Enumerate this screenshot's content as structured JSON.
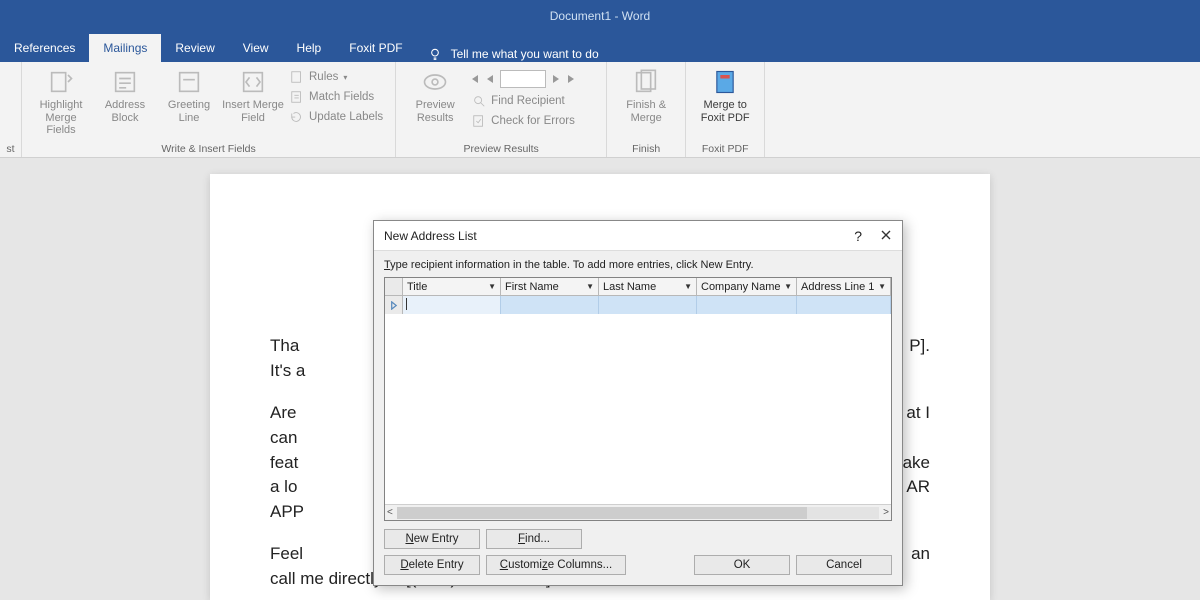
{
  "titlebar": {
    "title": "Document1  -  Word"
  },
  "tabs": [
    {
      "label": "References"
    },
    {
      "label": "Mailings",
      "active": true
    },
    {
      "label": "Review"
    },
    {
      "label": "View"
    },
    {
      "label": "Help"
    },
    {
      "label": "Foxit PDF"
    }
  ],
  "tellme": {
    "label": "Tell me what you want to do"
  },
  "ribbon": {
    "truncated": {
      "label": "st"
    },
    "writeInsert": {
      "label": "Write & Insert Fields",
      "highlight": "Highlight Merge Fields",
      "address": "Address Block",
      "greeting": "Greeting Line",
      "insert": "Insert Merge Field",
      "rules": "Rules",
      "match": "Match Fields",
      "update": "Update Labels"
    },
    "preview": {
      "label": "Preview Results",
      "preview": "Preview Results",
      "find": "Find Recipient",
      "check": "Check for Errors"
    },
    "finish": {
      "label": "Finish",
      "finish": "Finish & Merge"
    },
    "foxit": {
      "label": "Foxit PDF",
      "merge": "Merge to Foxit PDF"
    }
  },
  "document": {
    "p1a": "Tha",
    "p1b": "P].",
    "p2": "It's a",
    "p3a": "Are",
    "p3b": "at I",
    "p4": "can",
    "p5a": "feat",
    "p5b": "ake",
    "p6a": "a lo",
    "p6b": "AR",
    "p7": "APP",
    "p8a": "Feel",
    "p8b": "an",
    "p9": "call me directly at [(XXX) XXX-XXXX]."
  },
  "dialog": {
    "title": "New Address List",
    "help": "?",
    "instruction": "Type recipient information in the table.  To add more entries, click New Entry.",
    "columns": [
      "Title",
      "First Name",
      "Last Name",
      "Company Name",
      "Address Line 1"
    ],
    "buttons": {
      "newEntry": "New Entry",
      "find": "Find...",
      "deleteEntry": "Delete Entry",
      "customize": "Customize Columns...",
      "ok": "OK",
      "cancel": "Cancel"
    }
  }
}
